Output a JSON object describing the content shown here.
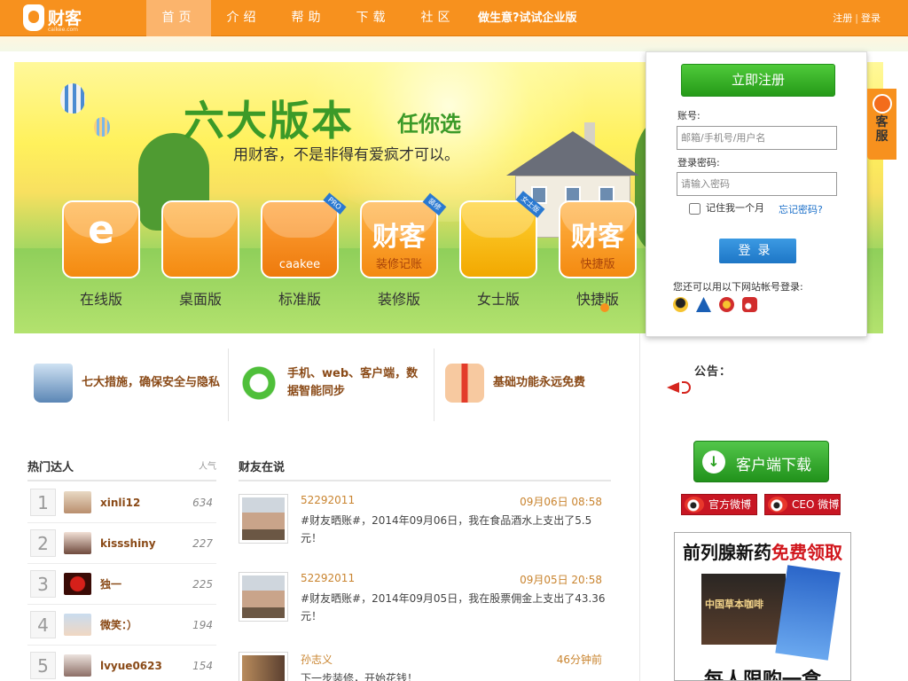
{
  "nav": {
    "logo_name": "财客",
    "logo_sub": "caikee.com",
    "items": [
      {
        "label": "首页"
      },
      {
        "label": "介绍"
      },
      {
        "label": "帮助"
      },
      {
        "label": "下载"
      },
      {
        "label": "社区"
      }
    ],
    "promo": "做生意?试试企业版",
    "register": "注册",
    "sep": "|",
    "login": "登录"
  },
  "banner": {
    "headline": "六大版本",
    "headline_suffix": "任你选",
    "tagline": "用财客，不是非得有爱疯才可以。",
    "versions": [
      {
        "label": "在线版",
        "mark": "e"
      },
      {
        "label": "桌面版",
        "mark": ""
      },
      {
        "label": "标准版",
        "mark": "",
        "tile_text": "caakee",
        "ribbon": "PRO"
      },
      {
        "label": "装修版",
        "mark": "财客",
        "tile_text": "装修记账",
        "ribbon": "装修"
      },
      {
        "label": "女士版",
        "mark": "",
        "ribbon": "女士版"
      },
      {
        "label": "快捷版",
        "mark": "财客",
        "tile_text": "快捷版"
      }
    ]
  },
  "login": {
    "register_button": "立即注册",
    "account_label": "账号:",
    "account_placeholder": "邮箱/手机号/用户名",
    "password_label": "登录密码:",
    "password_placeholder": "请输入密码",
    "remember": "记住我一个月",
    "forgot": "忘记密码?",
    "login_button": "登录",
    "third_party_text": "您还可以用以下网站帐号登录:"
  },
  "kefu": "客服",
  "features": [
    {
      "text": "七大措施，确保安全与隐私"
    },
    {
      "text": "手机、web、客户端，数据智能同步"
    },
    {
      "text": "基础功能永远免费"
    }
  ],
  "hot": {
    "title": "热门达人",
    "pop_header": "人气",
    "users": [
      {
        "rank": "1",
        "name": "xinli12",
        "pop": "634"
      },
      {
        "rank": "2",
        "name": "kissshiny",
        "pop": "227"
      },
      {
        "rank": "3",
        "name": "独一",
        "pop": "225"
      },
      {
        "rank": "4",
        "name": "微笑：）",
        "pop": "194"
      },
      {
        "rank": "5",
        "name": "lvyue0623",
        "pop": "154"
      }
    ]
  },
  "feed": {
    "title": "财友在说",
    "posts": [
      {
        "user": "52292011",
        "time": "09月06日 08:58",
        "text": "#财友晒账#，2014年09月06日，我在食品酒水上支出了5.5元！"
      },
      {
        "user": "52292011",
        "time": "09月05日 20:58",
        "text": "#财友晒账#，2014年09月05日，我在股票佣金上支出了43.36元！"
      },
      {
        "user": "孙志义",
        "time": "46分钟前",
        "text": "下一步装修，开始花钱！"
      }
    ]
  },
  "sidebar": {
    "notice_title": "公告：",
    "download_button": "客户端下载",
    "weibo_official": "官方微博",
    "weibo_ceo": "CEO 微博",
    "ad_headline_a": "前列腺新药",
    "ad_headline_b": "免费领取",
    "ad_product": "中国草本咖啡",
    "ad_footer": "每人限购一盒"
  },
  "colors": {
    "brand_orange": "#f7911e",
    "green": "#3b9a28",
    "link_blue": "#1a6fc9",
    "username_brown": "#8a4a17"
  }
}
